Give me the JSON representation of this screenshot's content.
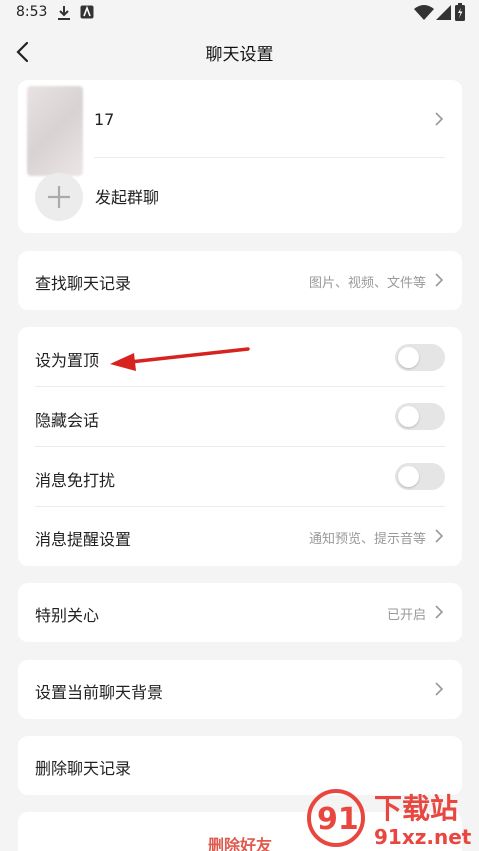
{
  "status_bar": {
    "time": "8:53"
  },
  "header": {
    "title": "聊天设置",
    "back_icon": "chevron-left-icon"
  },
  "members_card": {
    "member_name": "17",
    "add_group_label": "发起群聊"
  },
  "search_card": {
    "label": "查找聊天记录",
    "hint": "图片、视频、文件等"
  },
  "settings_card": {
    "pin_label": "设为置顶",
    "pin_on": false,
    "hide_label": "隐藏会话",
    "hide_on": false,
    "mute_label": "消息免打扰",
    "mute_on": false,
    "notify_label": "消息提醒设置",
    "notify_hint": "通知预览、提示音等"
  },
  "special_card": {
    "label": "特别关心",
    "hint": "已开启"
  },
  "background_card": {
    "label": "设置当前聊天背景"
  },
  "clear_card": {
    "label": "删除聊天记录"
  },
  "delete_card": {
    "label": "删除好友"
  },
  "watermark": {
    "text_top": "下载站",
    "text_bottom": "91xz.net",
    "logo": "91"
  },
  "colors": {
    "accent_red": "#e05a4f",
    "annotation_arrow": "#d8221f",
    "toggle_off": "#e5e5e5"
  }
}
